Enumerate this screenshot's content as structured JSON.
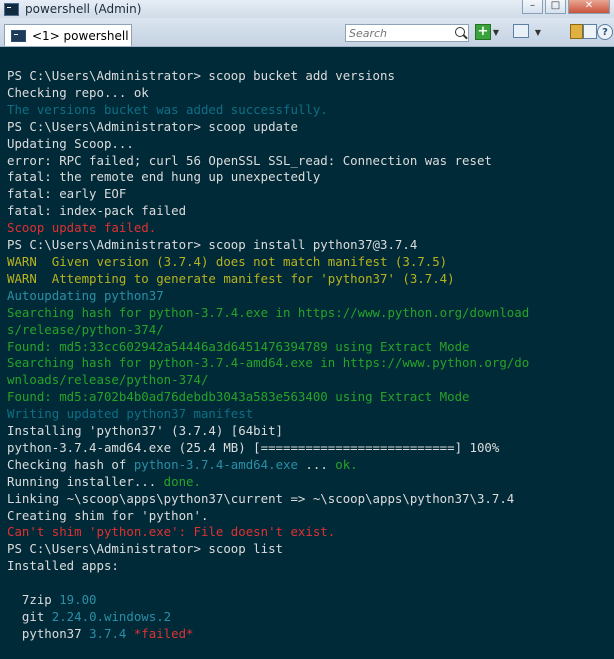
{
  "window": {
    "title": "powershell (Admin)"
  },
  "tabs": [
    {
      "label": "<1> powershell"
    }
  ],
  "toolbar": {
    "search_placeholder": "Search",
    "help_glyph": "?"
  },
  "colors": {
    "console_bg": "#012a39",
    "default": "#dcdcdc",
    "green": "#27a327",
    "red": "#e03030",
    "yellow": "#b8b21e",
    "cyan": "#2a8fa5",
    "teal": "#0f6e84"
  },
  "console_lines": [
    [
      {
        "t": "PS C:\\Users\\Administrator> scoop bucket add versions",
        "c": "default"
      }
    ],
    [
      {
        "t": "Checking repo... ok",
        "c": "default"
      }
    ],
    [
      {
        "t": "The versions bucket was added successfully.",
        "c": "teal"
      }
    ],
    [
      {
        "t": "PS C:\\Users\\Administrator> scoop update",
        "c": "default"
      }
    ],
    [
      {
        "t": "Updating Scoop...",
        "c": "default"
      }
    ],
    [
      {
        "t": "error: RPC failed; curl 56 OpenSSL SSL_read: Connection was reset",
        "c": "default"
      }
    ],
    [
      {
        "t": "fatal: the remote end hung up unexpectedly",
        "c": "default"
      }
    ],
    [
      {
        "t": "fatal: early EOF",
        "c": "default"
      }
    ],
    [
      {
        "t": "fatal: index-pack failed",
        "c": "default"
      }
    ],
    [
      {
        "t": "Scoop update failed.",
        "c": "red"
      }
    ],
    [
      {
        "t": "PS C:\\Users\\Administrator> scoop install python37@3.7.4",
        "c": "default"
      }
    ],
    [
      {
        "t": "WARN  Given version (3.7.4) does not match manifest (3.7.5)",
        "c": "yellow"
      }
    ],
    [
      {
        "t": "WARN  Attempting to generate manifest for 'python37' (3.7.4)",
        "c": "yellow"
      }
    ],
    [
      {
        "t": "Autoupdating python37",
        "c": "cyan"
      }
    ],
    [
      {
        "t": "Searching hash for python-3.7.4.exe in https://www.python.org/download",
        "c": "green"
      }
    ],
    [
      {
        "t": "s/release/python-374/",
        "c": "green"
      }
    ],
    [
      {
        "t": "Found: md5:33cc602942a54446a3d6451476394789 using Extract Mode",
        "c": "green"
      }
    ],
    [
      {
        "t": "Searching hash for python-3.7.4-amd64.exe in https://www.python.org/do",
        "c": "green"
      }
    ],
    [
      {
        "t": "wnloads/release/python-374/",
        "c": "green"
      }
    ],
    [
      {
        "t": "Found: md5:a702b4b0ad76debdb3043a583e563400 using Extract Mode",
        "c": "green"
      }
    ],
    [
      {
        "t": "Writing updated python37 manifest",
        "c": "teal"
      }
    ],
    [
      {
        "t": "Installing 'python37' (3.7.4) [64bit]",
        "c": "default"
      }
    ],
    [
      {
        "t": "python-3.7.4-amd64.exe (25.4 MB) [==========================] 100%",
        "c": "default"
      }
    ],
    [
      {
        "t": "Checking hash of ",
        "c": "default"
      },
      {
        "t": "python-3.7.4-amd64.exe",
        "c": "cyan"
      },
      {
        "t": " ... ",
        "c": "default"
      },
      {
        "t": "ok.",
        "c": "green"
      }
    ],
    [
      {
        "t": "Running installer... ",
        "c": "default"
      },
      {
        "t": "done.",
        "c": "green"
      }
    ],
    [
      {
        "t": "Linking ~\\scoop\\apps\\python37\\current => ~\\scoop\\apps\\python37\\3.7.4",
        "c": "default"
      }
    ],
    [
      {
        "t": "Creating shim for 'python'.",
        "c": "default"
      }
    ],
    [
      {
        "t": "Can't shim 'python.exe': File doesn't exist.",
        "c": "red"
      }
    ],
    [
      {
        "t": "PS C:\\Users\\Administrator> scoop list",
        "c": "default"
      }
    ],
    [
      {
        "t": "Installed apps:",
        "c": "default"
      }
    ],
    [
      {
        "t": "",
        "c": "default"
      }
    ],
    [
      {
        "t": "  7zip ",
        "c": "default"
      },
      {
        "t": "19.00",
        "c": "cyan"
      }
    ],
    [
      {
        "t": "  git ",
        "c": "default"
      },
      {
        "t": "2.24.0.windows.2",
        "c": "cyan"
      }
    ],
    [
      {
        "t": "  python37 ",
        "c": "default"
      },
      {
        "t": "3.7.4",
        "c": "cyan"
      },
      {
        "t": " *failed*",
        "c": "red"
      }
    ]
  ]
}
